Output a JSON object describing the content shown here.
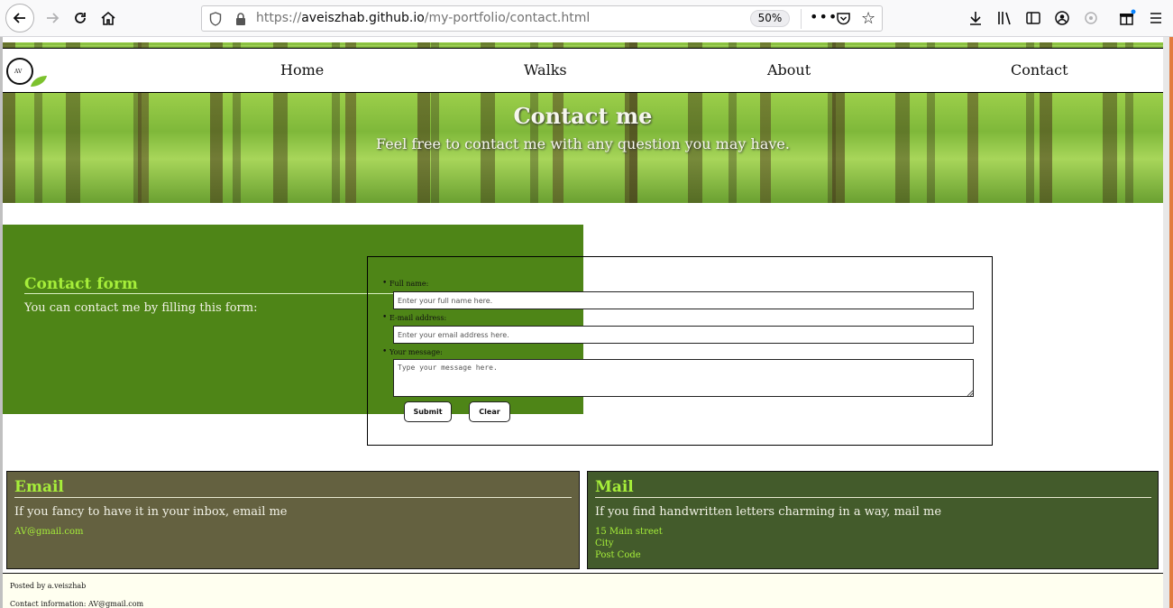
{
  "browser": {
    "url_scheme": "https://",
    "url_host": "aveiszhab.github.io",
    "url_path": "/my-portfolio/contact.html",
    "zoom": "50%"
  },
  "site": {
    "logo_text": "AV",
    "nav": [
      "Home",
      "Walks",
      "About",
      "Contact"
    ]
  },
  "hero": {
    "title": "Contact me",
    "subtitle": "Feel free to contact me with any question you may have."
  },
  "contact_form": {
    "heading": "Contact form",
    "intro": "You can contact me by filling this form:",
    "fields": {
      "name_label": "Full name:",
      "name_placeholder": "Enter your full name here.",
      "email_label": "E-mail address:",
      "email_placeholder": "Enter your email address here.",
      "message_label": "Your message:",
      "message_placeholder": "Type your message here."
    },
    "submit_label": "Submit",
    "clear_label": "Clear"
  },
  "email_card": {
    "title": "Email",
    "text": "If you fancy to have it in your inbox, email me",
    "address": "AV@gmail.com"
  },
  "mail_card": {
    "title": "Mail",
    "text": "If you find handwritten letters charming in a way, mail me",
    "lines": [
      "15 Main street",
      "City",
      "Post Code"
    ]
  },
  "footer": {
    "posted_by": "Posted by a.veiszhab",
    "contact": "Contact information: AV@gmail.com"
  },
  "colors": {
    "form_band": "#4e8517",
    "email_card": "#646140",
    "mail_card": "#435b2b",
    "accent_green": "#a6ee3a"
  }
}
